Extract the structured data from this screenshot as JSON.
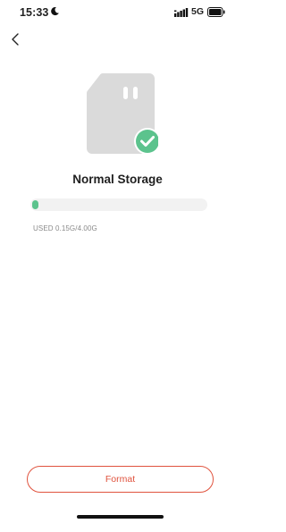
{
  "status_bar": {
    "time": "15:33",
    "network": "5G",
    "icons": [
      "moon-icon",
      "signal-icon",
      "battery-icon"
    ]
  },
  "header": {
    "back_icon": "chevron-left-icon"
  },
  "storage": {
    "icon": "sd-card-icon",
    "status_icon": "check-circle-icon",
    "title": "Normal Storage",
    "used_label": "USED 0.15G/4.00G",
    "used_fraction": 0.0375
  },
  "actions": {
    "format_label": "Format"
  },
  "colors": {
    "accent_green": "#5cc38d",
    "format_red": "#e0533e",
    "card_gray": "#dadada",
    "track_gray": "#f2f2f2"
  }
}
